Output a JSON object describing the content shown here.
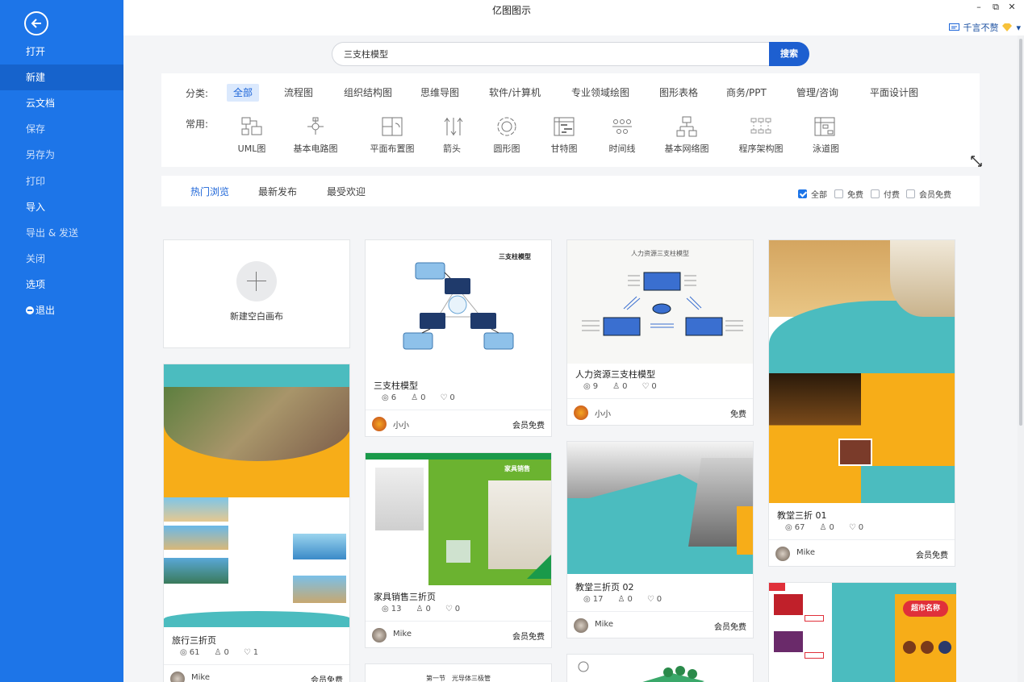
{
  "app": {
    "title": "亿图图示"
  },
  "window": {
    "minimize": "–",
    "restore": "⧉",
    "close": "✕"
  },
  "user": {
    "name": "千言不赘",
    "dropdown": "▾"
  },
  "sidebar": {
    "items": [
      {
        "label": "打开"
      },
      {
        "label": "新建"
      },
      {
        "label": "云文档"
      },
      {
        "label": "保存"
      },
      {
        "label": "另存为"
      },
      {
        "label": "打印"
      },
      {
        "label": "导入"
      },
      {
        "label": "导出 & 发送"
      },
      {
        "label": "关闭"
      },
      {
        "label": "选项"
      },
      {
        "label": "退出"
      }
    ]
  },
  "search": {
    "value": "三支柱模型",
    "button": "搜索"
  },
  "categories": {
    "label": "分类:",
    "items": [
      "全部",
      "流程图",
      "组织结构图",
      "思维导图",
      "软件/计算机",
      "专业领域绘图",
      "图形表格",
      "商务/PPT",
      "管理/咨询",
      "平面设计图"
    ]
  },
  "common": {
    "label": "常用:",
    "items": [
      "UML图",
      "基本电路图",
      "平面布置图",
      "箭头",
      "圆形图",
      "甘特图",
      "时间线",
      "基本网络图",
      "程序架构图",
      "泳道图"
    ]
  },
  "filters": {
    "tabs": [
      "热门浏览",
      "最新发布",
      "最受欢迎"
    ],
    "checks": [
      {
        "label": "全部",
        "checked": true
      },
      {
        "label": "免费",
        "checked": false
      },
      {
        "label": "付费",
        "checked": false
      },
      {
        "label": "会员免费",
        "checked": false
      }
    ]
  },
  "new_blank": {
    "label": "新建空白画布"
  },
  "cards": [
    {
      "title": "三支柱模型",
      "thumb_title": "三支柱模型",
      "views": "6",
      "likes": "0",
      "favs": "0",
      "author": "小小",
      "license": "会员免费"
    },
    {
      "title": "人力资源三支柱模型",
      "thumb_title": "人力资源三支柱模型",
      "views": "9",
      "likes": "0",
      "favs": "0",
      "author": "小小",
      "license": "免费"
    },
    {
      "title": "教堂三折 01",
      "views": "67",
      "likes": "0",
      "favs": "0",
      "author": "Mike",
      "license": "会员免费"
    },
    {
      "title": "旅行三折页",
      "views": "61",
      "likes": "0",
      "favs": "1",
      "author": "Mike",
      "license": "会员免费"
    },
    {
      "title": "家具销售三折页",
      "thumb_title": "家具销售",
      "views": "13",
      "likes": "0",
      "favs": "0",
      "author": "Mike",
      "license": "会员免费"
    },
    {
      "title": "教堂三折页 02",
      "views": "17",
      "likes": "0",
      "favs": "0",
      "author": "Mike",
      "license": "会员免费"
    }
  ],
  "partial_cards": {
    "chapter": "第一节　光导体三极管",
    "super": "超市名称"
  },
  "colors": {
    "sidebar": "#1d75e8",
    "sidebar_active": "#1663cc",
    "accent": "#1d65d8",
    "teal": "#4bbcbf",
    "orange": "#f7ad18",
    "green": "#6bb330"
  }
}
